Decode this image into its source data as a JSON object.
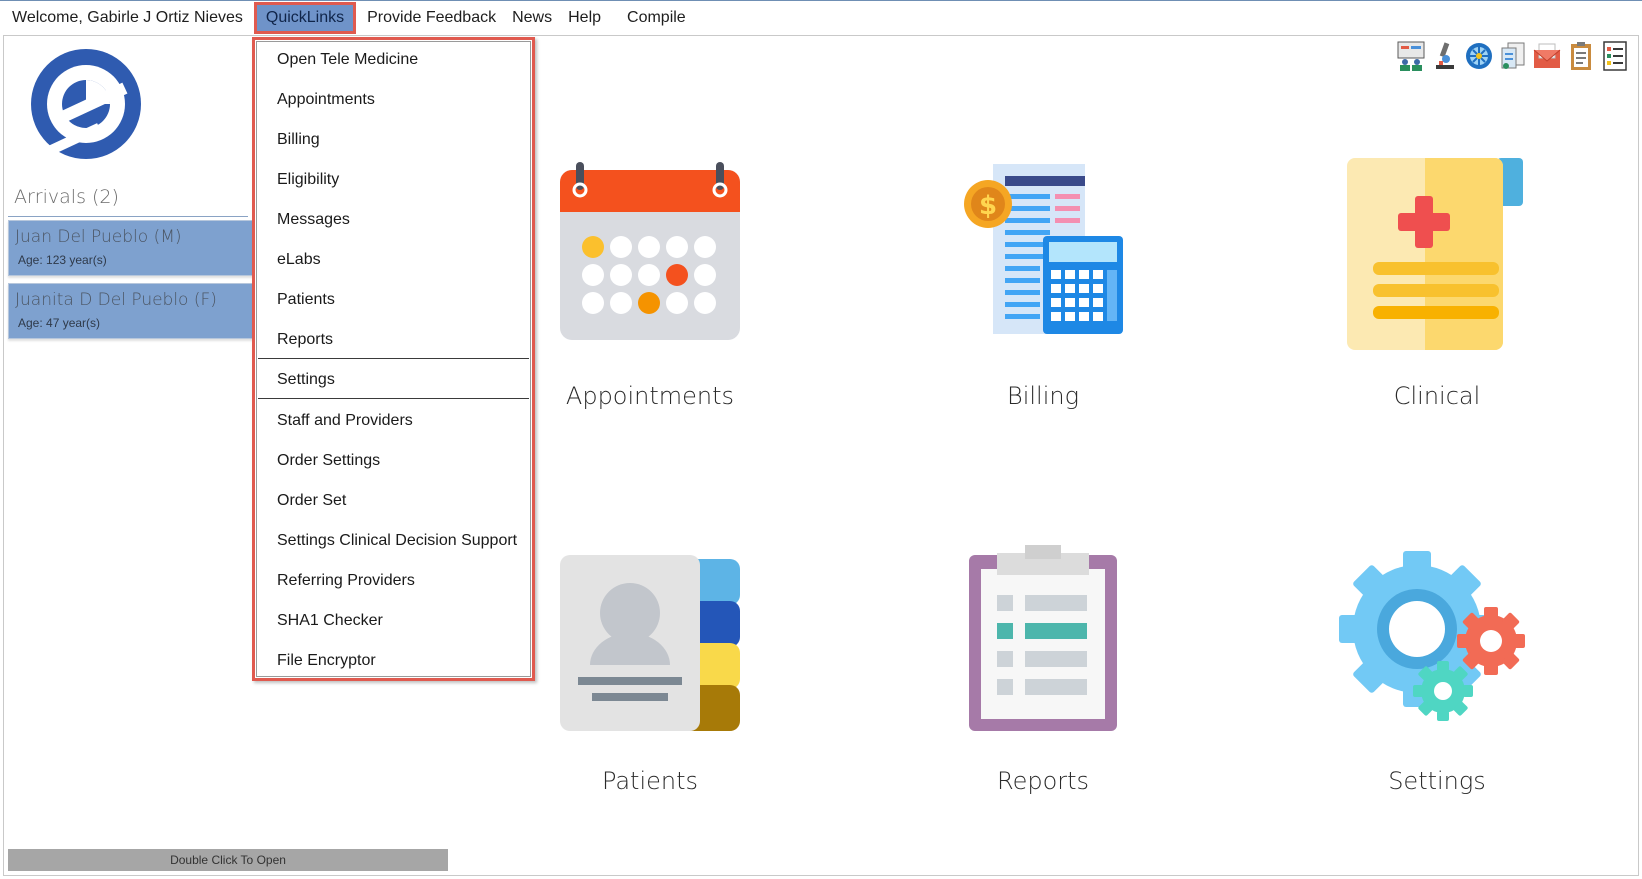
{
  "menubar": {
    "welcome": "Welcome, Gabirle J Ortiz Nieves",
    "quicklinks": "QuickLinks",
    "feedback": "Provide Feedback",
    "news": "News",
    "help": "Help",
    "compile": "Compile"
  },
  "quicklinks_menu": {
    "items": [
      "Open Tele Medicine",
      "Appointments",
      "Billing",
      "Eligibility",
      "Messages",
      "eLabs",
      "Patients",
      "Reports",
      "Settings",
      "Staff and Providers",
      "Order Settings",
      "Order Set",
      "Settings Clinical Decision Support",
      "Referring Providers",
      "SHA1 Checker",
      "File Encryptor"
    ]
  },
  "arrivals": {
    "title": "Arrivals (2)",
    "patients": [
      {
        "name": "Juan Del Pueblo (M)",
        "age": "Age: 123 year(s)"
      },
      {
        "name": "Juanita D Del Pueblo (F)",
        "age": "Age: 47 year(s)"
      }
    ],
    "open_hint": "Double Click To Open"
  },
  "tiles": {
    "appointments": "Appointments",
    "billing": "Billing",
    "clinical": "Clinical",
    "patients": "Patients",
    "reports": "Reports",
    "settings": "Settings"
  },
  "toolbar_icons": [
    "staff-icon",
    "microscope-icon",
    "network-icon",
    "documents-icon",
    "mail-icon",
    "clipboard-icon",
    "checklist-icon"
  ],
  "colors": {
    "menu_active_bg": "#6f93c9",
    "highlight_border": "#e05a4f",
    "patient_card_bg": "#7ea1cf",
    "logo_blue": "#2f5bb0"
  }
}
